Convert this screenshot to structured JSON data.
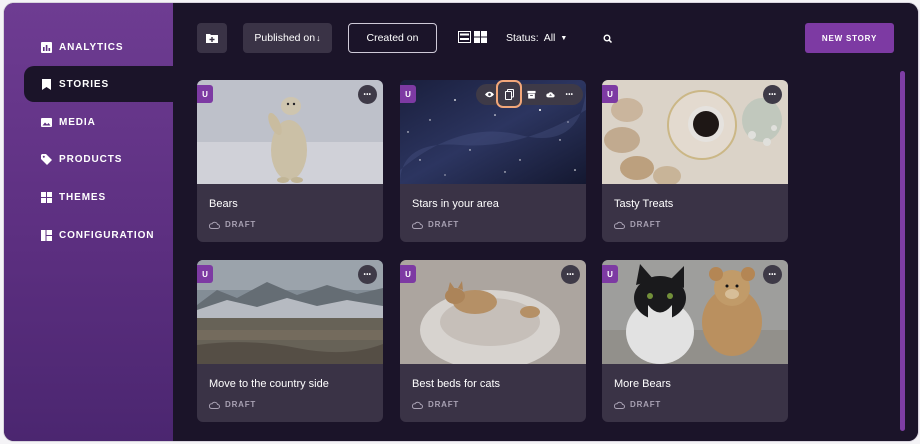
{
  "sidebar": {
    "items": [
      {
        "label": "ANALYTICS",
        "icon": "analytics-icon"
      },
      {
        "label": "STORIES",
        "icon": "stories-icon",
        "active": true
      },
      {
        "label": "MEDIA",
        "icon": "media-icon"
      },
      {
        "label": "PRODUCTS",
        "icon": "tag-icon"
      },
      {
        "label": "THEMES",
        "icon": "themes-icon"
      },
      {
        "label": "CONFIGURATION",
        "icon": "configuration-icon"
      }
    ]
  },
  "toolbar": {
    "sort_published": "Published on",
    "sort_published_arrow": "↓",
    "sort_created": "Created on",
    "status_label": "Status:",
    "status_value": "All",
    "new_story": "NEW STORY"
  },
  "cards": [
    {
      "title": "Bears",
      "status": "DRAFT",
      "badge": "U",
      "image": "polar-bear"
    },
    {
      "title": "Stars in your area",
      "status": "DRAFT",
      "badge": "U",
      "image": "starry-sky"
    },
    {
      "title": "Tasty Treats",
      "status": "DRAFT",
      "badge": "U",
      "image": "macarons-coffee"
    },
    {
      "title": "Move to the country side",
      "status": "DRAFT",
      "badge": "U",
      "image": "countryside"
    },
    {
      "title": "Best beds for cats",
      "status": "DRAFT",
      "badge": "U",
      "image": "cat-in-bed"
    },
    {
      "title": "More Bears",
      "status": "DRAFT",
      "badge": "U",
      "image": "cat-and-teddy"
    }
  ],
  "card_more": "•••",
  "colors": {
    "accent": "#7d3aa3",
    "background": "#1b1429",
    "card": "#3a3346",
    "highlight": "#f2a77a"
  }
}
